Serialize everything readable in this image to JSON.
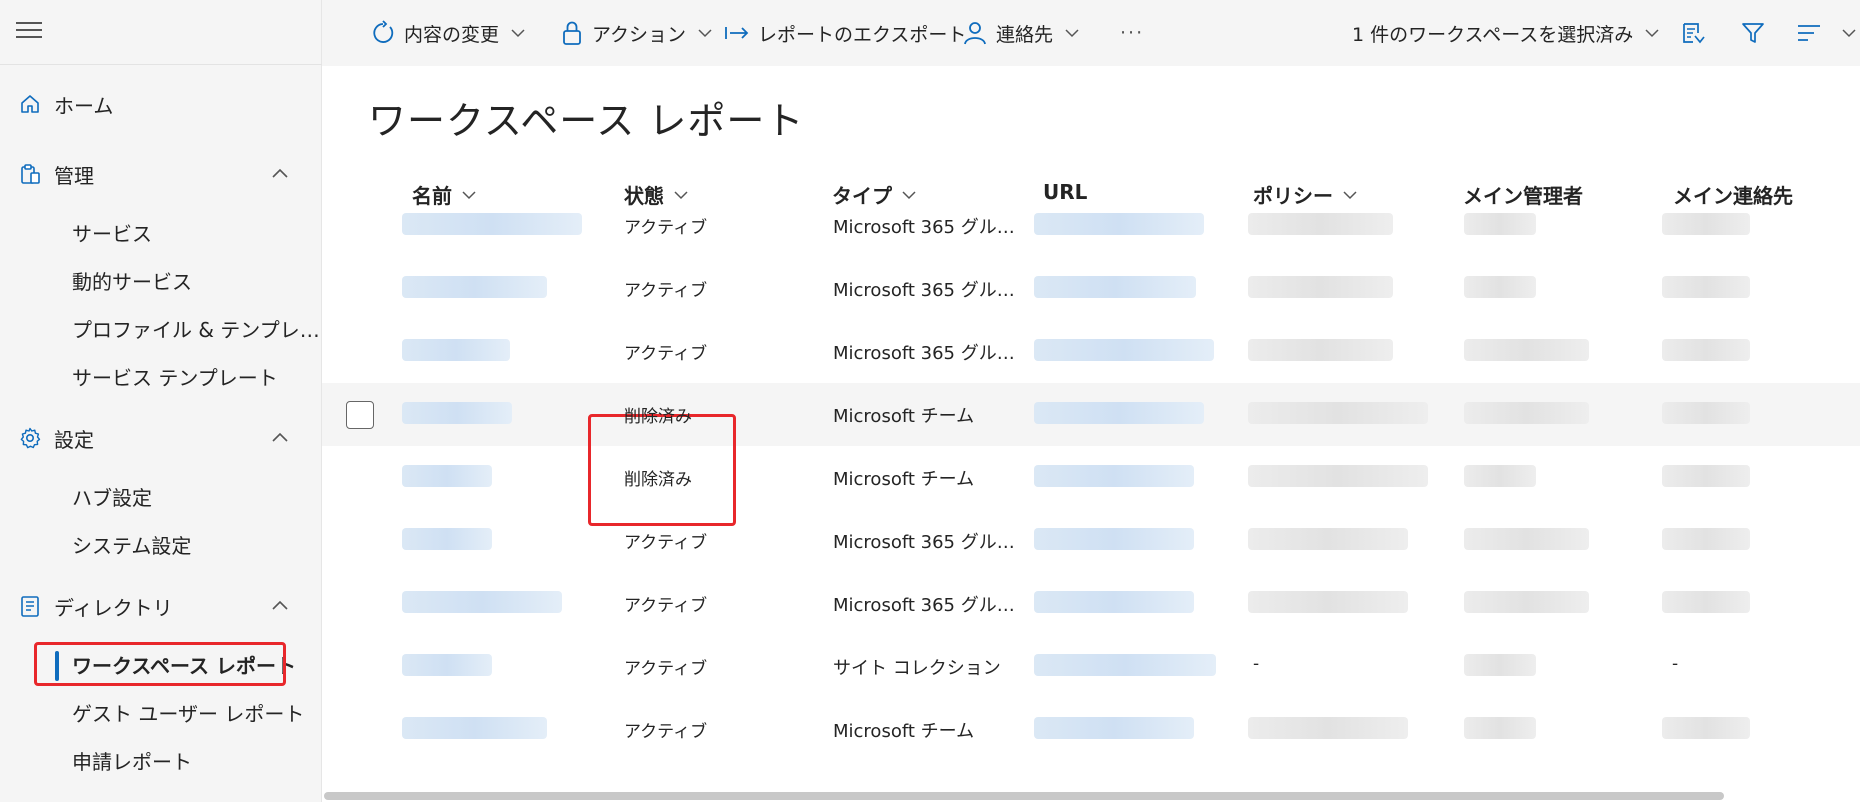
{
  "toolbar": {
    "change_content": "内容の変更",
    "action": "アクション",
    "export": "レポートのエクスポート",
    "contact": "連絡先",
    "more": "···",
    "selection": "1 件のワークスペースを選択済み"
  },
  "sidebar": {
    "home": "ホーム",
    "manage": "管理",
    "manage_items": [
      "サービス",
      "動的サービス",
      "プロファイル & テンプレ…",
      "サービス テンプレート"
    ],
    "settings": "設定",
    "settings_items": [
      "ハブ設定",
      "システム設定"
    ],
    "directory": "ディレクトリ",
    "directory_items": [
      "ワークスペース レポート",
      "ゲスト ユーザー レポート",
      "申請レポート"
    ]
  },
  "page": {
    "title": "ワークスペース レポート"
  },
  "table": {
    "columns": [
      "名前",
      "状態",
      "タイプ",
      "URL",
      "ポリシー",
      "メイン管理者",
      "メイン連絡先"
    ],
    "rows": [
      {
        "status": "アクティブ",
        "type": "Microsoft 365 グル…",
        "policy": "",
        "contact": ""
      },
      {
        "status": "アクティブ",
        "type": "Microsoft 365 グル…",
        "policy": "",
        "contact": ""
      },
      {
        "status": "アクティブ",
        "type": "Microsoft 365 グル…",
        "policy": "",
        "contact": ""
      },
      {
        "status": "削除済み",
        "type": "Microsoft チーム",
        "policy": "",
        "contact": ""
      },
      {
        "status": "削除済み",
        "type": "Microsoft チーム",
        "policy": "",
        "contact": ""
      },
      {
        "status": "アクティブ",
        "type": "Microsoft 365 グル…",
        "policy": "",
        "contact": ""
      },
      {
        "status": "アクティブ",
        "type": "Microsoft 365 グル…",
        "policy": "",
        "contact": ""
      },
      {
        "status": "アクティブ",
        "type": "サイト コレクション",
        "policy": "-",
        "contact": "-"
      },
      {
        "status": "アクティブ",
        "type": "Microsoft チーム",
        "policy": "",
        "contact": ""
      }
    ]
  },
  "colors": {
    "accent": "#0f6cbd",
    "highlight": "#e8272b"
  }
}
